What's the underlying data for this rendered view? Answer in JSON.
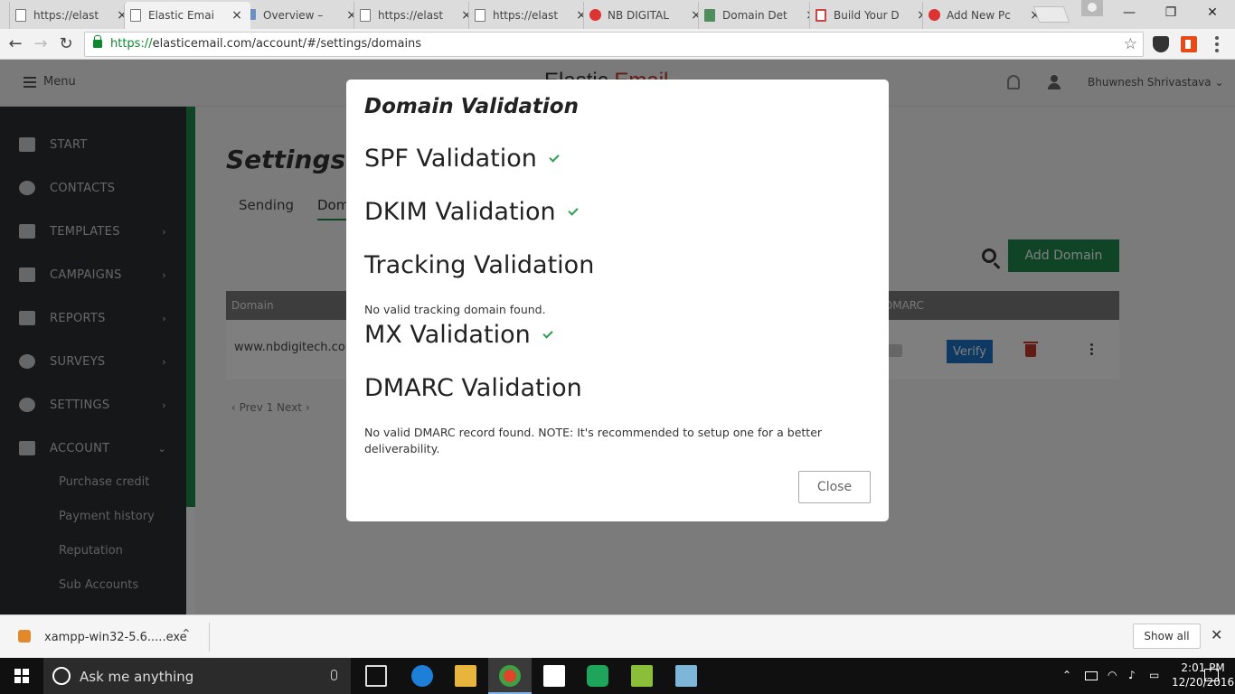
{
  "browser": {
    "tabs": [
      {
        "label": "https://elast",
        "icon": "page-icon"
      },
      {
        "label": "Elastic Emai",
        "icon": "page-icon"
      },
      {
        "label": "Overview – ",
        "icon": "cloud-icon"
      },
      {
        "label": "https://elast",
        "icon": "page-icon"
      },
      {
        "label": "https://elast",
        "icon": "page-icon"
      },
      {
        "label": "NB DIGITAL",
        "icon": "nb-logo-icon"
      },
      {
        "label": "Domain Det",
        "icon": "domain-icon"
      },
      {
        "label": "Build Your D",
        "icon": "build-icon"
      },
      {
        "label": "Add New Pc",
        "icon": "nb-logo-icon"
      }
    ],
    "active_tab_index": 1,
    "url_scheme": "https://",
    "url_rest": "elasticemail.com/account/#/settings/domains"
  },
  "header": {
    "menu_label": "Menu",
    "brand_part1": "Elastic",
    "brand_part2": "Email",
    "user_name": "Bhuwnesh Shrivastava"
  },
  "sidebar": {
    "items": [
      {
        "label": "START",
        "icon": "home-icon",
        "arrow": ""
      },
      {
        "label": "CONTACTS",
        "icon": "contacts-icon",
        "arrow": ""
      },
      {
        "label": "TEMPLATES",
        "icon": "templates-icon",
        "arrow": "›"
      },
      {
        "label": "CAMPAIGNS",
        "icon": "wand-icon",
        "arrow": "›"
      },
      {
        "label": "REPORTS",
        "icon": "chart-icon",
        "arrow": "›"
      },
      {
        "label": "SURVEYS",
        "icon": "comment-icon",
        "arrow": "›"
      },
      {
        "label": "SETTINGS",
        "icon": "gear-icon",
        "arrow": "›"
      },
      {
        "label": "ACCOUNT",
        "icon": "user-icon",
        "arrow": "⌄"
      }
    ],
    "sub_items": [
      "Purchase credit",
      "Payment history",
      "Reputation",
      "Sub Accounts"
    ]
  },
  "main": {
    "title": "Settings",
    "tab_sending": "Sending",
    "tab_domains": "Domains",
    "add_domain_label": "Add Domain",
    "table": {
      "col_domain": "Domain",
      "col_dmarc": "DMARC",
      "row_domain": "www.nbdigitech.com",
      "verify_label": "Verify"
    },
    "pager": "‹ Prev   1   Next ›"
  },
  "modal": {
    "title": "Domain Validation",
    "sections": [
      {
        "heading": "SPF Validation",
        "valid": true,
        "note": ""
      },
      {
        "heading": "DKIM Validation",
        "valid": true,
        "note": ""
      },
      {
        "heading": "Tracking Validation",
        "valid": false,
        "note": "No valid tracking domain found."
      },
      {
        "heading": "MX Validation",
        "valid": true,
        "note": ""
      },
      {
        "heading": "DMARC Validation",
        "valid": false,
        "note": "No valid DMARC record found. NOTE: It's recommended to setup one for a better deliverability."
      }
    ],
    "close_label": "Close"
  },
  "downloads": {
    "file_name": "xampp-win32-5.6.....exe",
    "show_all_label": "Show all"
  },
  "taskbar": {
    "search_placeholder": "Ask me anything",
    "time": "2:01 PM",
    "date": "12/20/2016"
  },
  "colors": {
    "accent_green": "#1f8a4c",
    "verify_blue": "#1a73c4",
    "check_green": "#2e9e4f",
    "brand_red": "#c0392b"
  }
}
